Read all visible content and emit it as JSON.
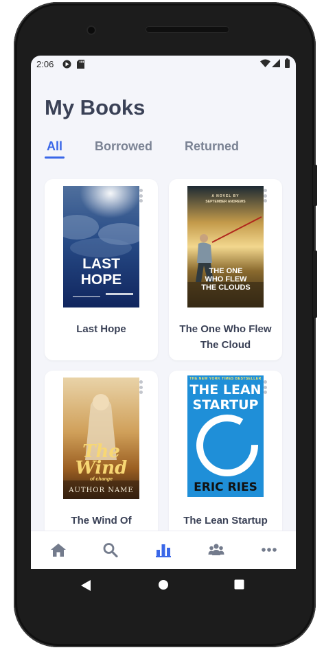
{
  "status": {
    "time": "2:06",
    "icons": [
      "play-protect-icon",
      "sd-card-icon",
      "wifi-icon",
      "signal-icon",
      "battery-icon"
    ]
  },
  "page": {
    "title": "My Books"
  },
  "tabs": [
    {
      "label": "All",
      "active": true
    },
    {
      "label": "Borrowed",
      "active": false
    },
    {
      "label": "Returned",
      "active": false
    }
  ],
  "books": [
    {
      "title": "Last Hope",
      "cover_title": "LAST\nHOPE"
    },
    {
      "title": "The One Who Flew The Cloud",
      "cover_kicker": "A NOVEL BY",
      "cover_author": "SEPTEMBER ANDREWS",
      "cover_title": "THE ONE\nWHO FLEW\nTHE CLOUDS"
    },
    {
      "title": "The Wind Of",
      "cover_title": "The\nWind",
      "cover_subtitle": "of change",
      "cover_author": "AUTHOR NAME"
    },
    {
      "title": "The Lean Startup",
      "cover_banner": "THE NEW YORK TIMES BESTSELLER",
      "cover_title": "THE LEAN\nSTARTUP",
      "cover_author": "ERIC RIES"
    }
  ],
  "bottom_nav": [
    {
      "icon": "home-icon",
      "active": false
    },
    {
      "icon": "search-icon",
      "active": false
    },
    {
      "icon": "bar-chart-icon",
      "active": true
    },
    {
      "icon": "users-icon",
      "active": false
    },
    {
      "icon": "more-horizontal-icon",
      "active": false
    }
  ],
  "colors": {
    "accent": "#3a67e8",
    "title": "#3a4156",
    "tab_inactive": "#7b8394",
    "background": "#f4f5fa"
  }
}
